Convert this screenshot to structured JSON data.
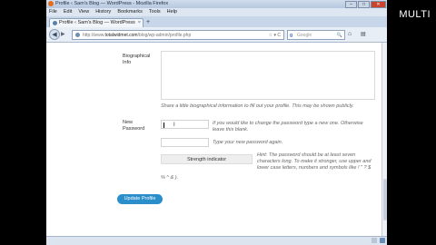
{
  "overlay_label": "MULTI",
  "window": {
    "title": "Profile ‹ Sam's Blog — WordPress - Mozilla Firefox",
    "buttons": {
      "minimize": "–",
      "maximize": "□",
      "close": "✕"
    }
  },
  "menu": [
    "File",
    "Edit",
    "View",
    "History",
    "Bookmarks",
    "Tools",
    "Help"
  ],
  "tab": {
    "label": "Profile ‹ Sam's Blog — WordPress",
    "close": "×",
    "new_tab": "+"
  },
  "nav": {
    "url_prefix": "http://www.",
    "url_domain": "totalwidmet.com",
    "url_path": "/blog/wp-admin/profile.php",
    "url_right": "☆ ▾ C",
    "search_engine": "g",
    "search_placeholder": "Google",
    "search_button": "🔍",
    "back": "◀",
    "forward": "▶",
    "home": "⌂",
    "bookmarks": "▤"
  },
  "form": {
    "bio_label_line1": "Biographical",
    "bio_label_line2": "Info",
    "bio_value": "",
    "bio_desc": "Share a little biographical information to fill out your profile. This may be shown publicly.",
    "pw_label_line1": "New",
    "pw_label_line2": "Password",
    "pw_desc_line1": "If you would like to change the password type a new one. Otherwise",
    "pw_desc_line2": "leave this blank.",
    "pw_confirm_desc": "Type your new password again.",
    "strength_label": "Strength indicator",
    "hint_line1": "Hint: The password should be at least seven",
    "hint_line2": "characters long. To make it stronger, use upper and",
    "hint_line3": "lower case letters, numbers and symbols like ! \" ? $",
    "hint_line4": "% ^ & ).",
    "update_button": "Update Profile"
  },
  "colors": {
    "primary_button": "#2a8ecb",
    "titlebar": "#cfdcec",
    "background": "#000000"
  }
}
